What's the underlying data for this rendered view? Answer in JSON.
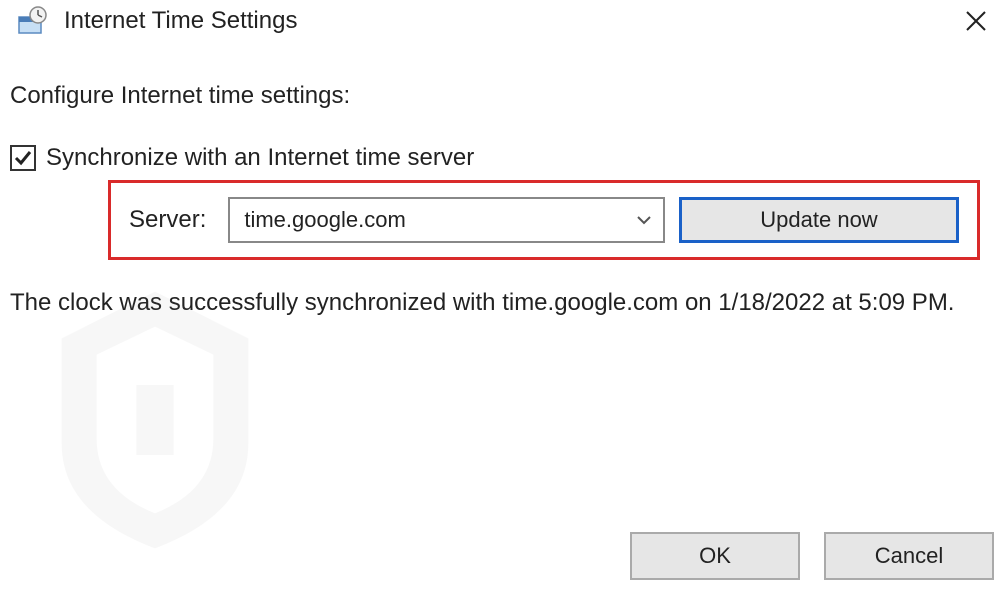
{
  "window": {
    "title": "Internet Time Settings"
  },
  "content": {
    "configure_label": "Configure Internet time settings:",
    "sync_checkbox_label": "Synchronize with an Internet time server",
    "server_label": "Server:",
    "server_value": "time.google.com",
    "update_button": "Update now",
    "status_text": "The clock was successfully synchronized with time.google.com on 1/18/2022 at 5:09 PM."
  },
  "buttons": {
    "ok": "OK",
    "cancel": "Cancel"
  }
}
